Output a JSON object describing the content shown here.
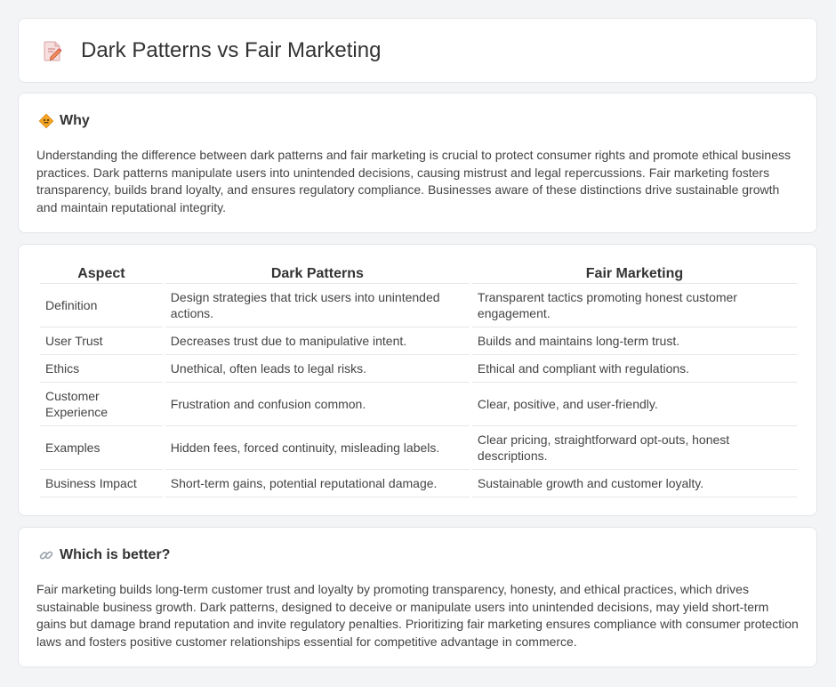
{
  "header": {
    "title": "Dark Patterns vs Fair Marketing",
    "icon": "document-pencil-icon"
  },
  "why": {
    "heading": "Why",
    "icon": "diamond-sign-icon",
    "body": "Understanding the difference between dark patterns and fair marketing is crucial to protect consumer rights and promote ethical business practices. Dark patterns manipulate users into unintended decisions, causing mistrust and legal repercussions. Fair marketing fosters transparency, builds brand loyalty, and ensures regulatory compliance. Businesses aware of these distinctions drive sustainable growth and maintain reputational integrity."
  },
  "table": {
    "headers": [
      "Aspect",
      "Dark Patterns",
      "Fair Marketing"
    ],
    "rows": [
      [
        "Definition",
        "Design strategies that trick users into unintended actions.",
        "Transparent tactics promoting honest customer engagement."
      ],
      [
        "User Trust",
        "Decreases trust due to manipulative intent.",
        "Builds and maintains long-term trust."
      ],
      [
        "Ethics",
        "Unethical, often leads to legal risks.",
        "Ethical and compliant with regulations."
      ],
      [
        "Customer Experience",
        "Frustration and confusion common.",
        "Clear, positive, and user-friendly."
      ],
      [
        "Examples",
        "Hidden fees, forced continuity, misleading labels.",
        "Clear pricing, straightforward opt-outs, honest descriptions."
      ],
      [
        "Business Impact",
        "Short-term gains, potential reputational damage.",
        "Sustainable growth and customer loyalty."
      ]
    ]
  },
  "better": {
    "heading": "Which is better?",
    "icon": "link-icon",
    "body": "Fair marketing builds long-term customer trust and loyalty by promoting transparency, honesty, and ethical practices, which drives sustainable business growth. Dark patterns, designed to deceive or manipulate users into unintended decisions, may yield short-term gains but damage brand reputation and invite regulatory penalties. Prioritizing fair marketing ensures compliance with consumer protection laws and fosters positive customer relationships essential for competitive advantage in commerce."
  },
  "colors": {
    "background": "#f3f4f6",
    "card": "#ffffff",
    "accent_orange": "#f5a623",
    "icon_pink": "#e9687a"
  }
}
